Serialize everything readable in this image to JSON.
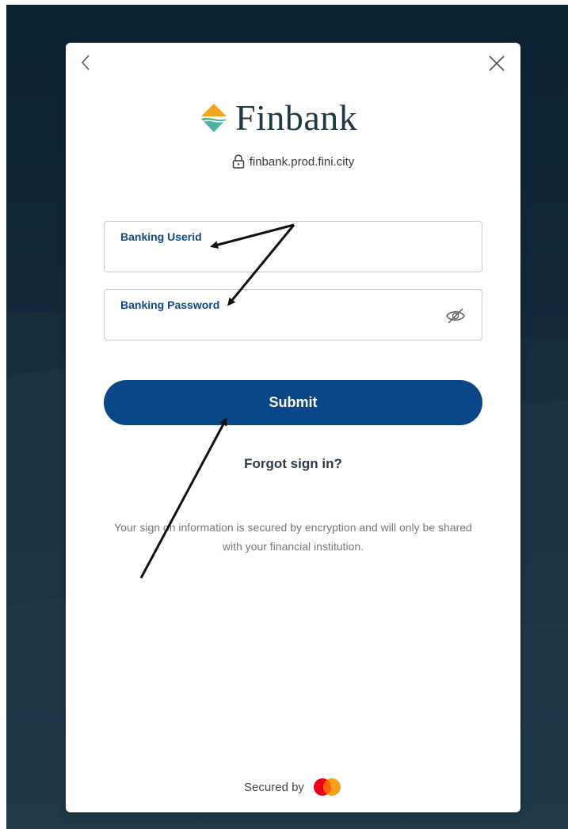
{
  "brand": {
    "name": "Finbank",
    "domain": "finbank.prod.fini.city",
    "text_color": "#1f3a46",
    "mark_colors": [
      "#f2a61d",
      "#4bb3a3"
    ]
  },
  "nav": {
    "back_icon": "chevron-left-icon",
    "close_icon": "close-icon"
  },
  "form": {
    "userid_label": "Banking Userid",
    "userid_value": "",
    "password_label": "Banking Password",
    "password_value": "",
    "password_toggle_icon": "eye-slash-icon",
    "label_color": "#0e4a86",
    "submit_label": "Submit",
    "submit_color": "#0b4687"
  },
  "forgot_link": "Forgot sign in?",
  "security_note": "Your sign on information is secured by encryption and will only be shared with your financial institution.",
  "footer": {
    "secured_by_label": "Secured by",
    "provider_icon": "mastercard-logo-icon"
  },
  "annotation_arrows": {
    "color": "#111111",
    "count": 3
  }
}
